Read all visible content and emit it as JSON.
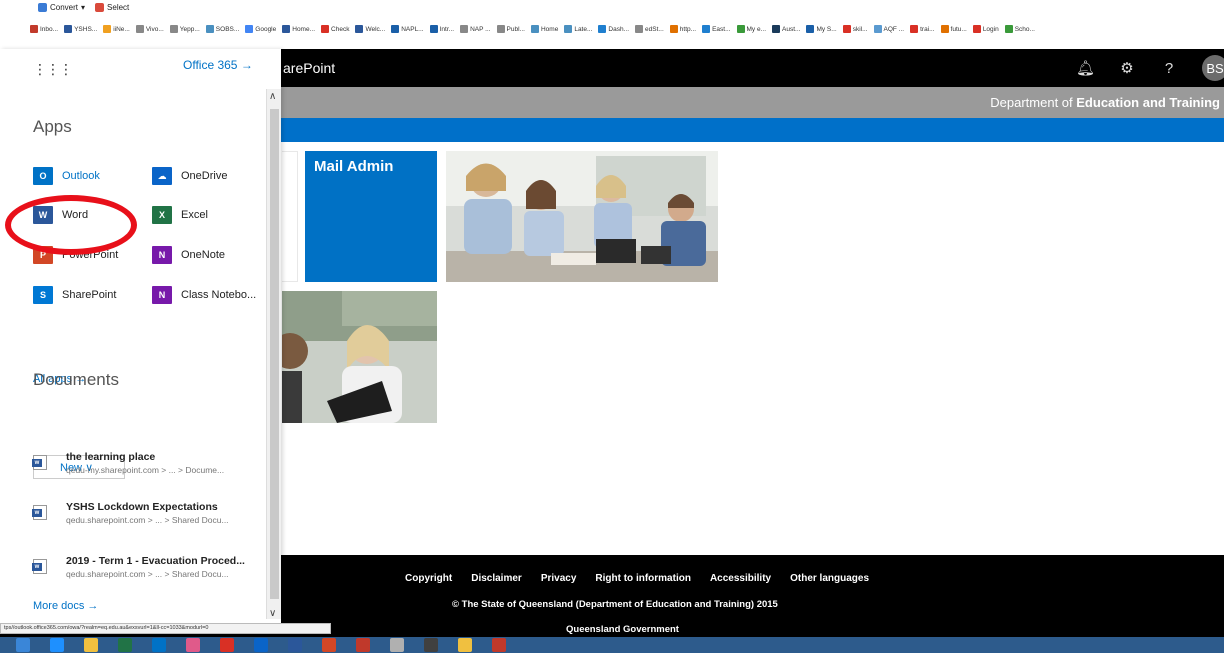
{
  "browser": {
    "ext_bar": [
      {
        "label": "Convert",
        "icon": "convert-icon",
        "color": "#3a7bd5"
      },
      {
        "label": "Select",
        "icon": "select-icon",
        "color": "#d94a3b"
      }
    ],
    "bookmarks": [
      {
        "label": "Inbo...",
        "color": "#c23a2b"
      },
      {
        "label": "YSHS...",
        "color": "#2b579a"
      },
      {
        "label": "iiNe...",
        "color": "#f0a020"
      },
      {
        "label": "Vivo...",
        "color": "#888888"
      },
      {
        "label": "Yepp...",
        "color": "#888888"
      },
      {
        "label": "SOBS...",
        "color": "#4a90c0"
      },
      {
        "label": "Google",
        "color": "#4285f4"
      },
      {
        "label": "Home...",
        "color": "#2b579a"
      },
      {
        "label": "Check",
        "color": "#d93025"
      },
      {
        "label": "Welc...",
        "color": "#2b579a"
      },
      {
        "label": "NAPL...",
        "color": "#1a5fa8"
      },
      {
        "label": "Intr...",
        "color": "#1a5fa8"
      },
      {
        "label": "NAP ...",
        "color": "#888888"
      },
      {
        "label": "Publ...",
        "color": "#888888"
      },
      {
        "label": "Home",
        "color": "#4a90c0"
      },
      {
        "label": "Late...",
        "color": "#4a90c0"
      },
      {
        "label": "Dash...",
        "color": "#1f7fcf"
      },
      {
        "label": "edSt...",
        "color": "#888888"
      },
      {
        "label": "http...",
        "color": "#e07000"
      },
      {
        "label": "East...",
        "color": "#1f7fcf"
      },
      {
        "label": "My e...",
        "color": "#3a9a3a"
      },
      {
        "label": "Aust...",
        "color": "#1a3a5a"
      },
      {
        "label": "My S...",
        "color": "#1a5fa8"
      },
      {
        "label": "skil...",
        "color": "#d93025"
      },
      {
        "label": "AQF ...",
        "color": "#5a9ad0"
      },
      {
        "label": "trai...",
        "color": "#d93025"
      },
      {
        "label": "futu...",
        "color": "#e07000"
      },
      {
        "label": "Login",
        "color": "#d93025"
      },
      {
        "label": "Scho...",
        "color": "#3a9a3a"
      }
    ]
  },
  "header": {
    "title": "arePoint",
    "avatar": "BS",
    "dept_prefix": "Department of ",
    "dept_bold": "Education and Training"
  },
  "tiles": {
    "mail_admin": "Mail Admin",
    "blank_char": ":"
  },
  "launcher": {
    "office_link": "Office 365",
    "office_arrow": "→",
    "apps_heading": "Apps",
    "apps": [
      {
        "label": "Outlook",
        "icon": "outlook-icon",
        "glyph": "O",
        "color": "#0072c6"
      },
      {
        "label": "OneDrive",
        "icon": "onedrive-icon",
        "glyph": "☁",
        "color": "#0a64c8"
      },
      {
        "label": "Word",
        "icon": "word-icon",
        "glyph": "W",
        "color": "#2b579a"
      },
      {
        "label": "Excel",
        "icon": "excel-icon",
        "glyph": "X",
        "color": "#217346"
      },
      {
        "label": "PowerPoint",
        "icon": "powerpoint-icon",
        "glyph": "P",
        "color": "#d24726"
      },
      {
        "label": "OneNote",
        "icon": "onenote-icon",
        "glyph": "N",
        "color": "#7719aa"
      },
      {
        "label": "SharePoint",
        "icon": "sharepoint-icon",
        "glyph": "S",
        "color": "#0078d4"
      },
      {
        "label": "Class Notebo...",
        "icon": "class-notebook-icon",
        "glyph": "N",
        "color": "#7719aa"
      }
    ],
    "all_apps": "All apps",
    "all_apps_arrow": "→",
    "documents_heading": "Documents",
    "new_label": "New",
    "new_chevron": "∨",
    "docs": [
      {
        "title": "the learning place",
        "path": "qedu-my.sharepoint.com > ... > Docume..."
      },
      {
        "title": "YSHS Lockdown Expectations",
        "path": "qedu.sharepoint.com > ... > Shared Docu..."
      },
      {
        "title": "2019 - Term 1 - Evacuation Proced...",
        "path": "qedu.sharepoint.com > ... > Shared Docu..."
      }
    ],
    "more_docs": "More docs",
    "more_docs_arrow": "→"
  },
  "status_url": "tps//outlook.office365.com/owa/?realm=eq.edu.au&exsvurl=1&ll-cc=1033&modurl=0",
  "footer": {
    "links": [
      "Copyright",
      "Disclaimer",
      "Privacy",
      "Right to information",
      "Accessibility",
      "Other languages"
    ],
    "copyright": "© The State of Queensland (Department of Education and Training) 2015",
    "gov": "Queensland Government"
  },
  "taskbar": [
    {
      "icon": "task-view-icon",
      "color": "#3a86d8"
    },
    {
      "icon": "ie-icon",
      "color": "#1e90ff"
    },
    {
      "icon": "file-explorer-icon",
      "color": "#f0c040"
    },
    {
      "icon": "excel-taskbar-icon",
      "color": "#217346"
    },
    {
      "icon": "outlook-taskbar-icon",
      "color": "#0072c6"
    },
    {
      "icon": "app-pink-icon",
      "color": "#e05a8a"
    },
    {
      "icon": "chrome-icon",
      "color": "#d93025"
    },
    {
      "icon": "onedrive-taskbar-icon",
      "color": "#0a64c8"
    },
    {
      "icon": "word-taskbar-icon",
      "color": "#2b579a"
    },
    {
      "icon": "powerpoint-taskbar-icon",
      "color": "#d24726"
    },
    {
      "icon": "record-icon",
      "color": "#c0392b"
    },
    {
      "icon": "paint-icon",
      "color": "#b0b0b0"
    },
    {
      "icon": "snipping-icon",
      "color": "#404040"
    },
    {
      "icon": "folder-icon",
      "color": "#f0c040"
    },
    {
      "icon": "acrobat-icon",
      "color": "#c0392b"
    }
  ]
}
